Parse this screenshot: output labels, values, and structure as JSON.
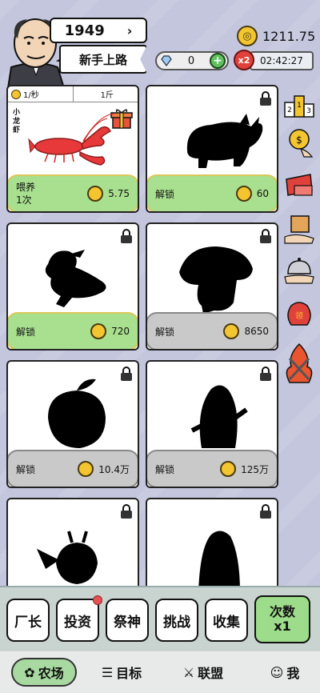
{
  "header": {
    "year": "1949",
    "title": "新手上路",
    "gold": "1211.75",
    "gems": "0",
    "boost_badge": "x2",
    "timer": "02:42:27"
  },
  "cards": [
    {
      "rate": "1/秒",
      "weight": "1斤",
      "name": "小龙虾",
      "action": "喂养",
      "sub": "1次",
      "price": "5.75",
      "style": "green"
    },
    {
      "action": "解锁",
      "price": "60",
      "style": "green"
    },
    {
      "action": "解锁",
      "price": "720",
      "style": "green"
    },
    {
      "action": "解锁",
      "price": "8650",
      "style": "grey"
    },
    {
      "action": "解锁",
      "price": "10.4万",
      "style": "grey"
    },
    {
      "action": "解锁",
      "price": "125万",
      "style": "grey"
    }
  ],
  "side": {
    "ranking_digits": [
      "2",
      "1",
      "3"
    ],
    "coupon_label": "领"
  },
  "toolbar": {
    "factory": "厂长",
    "invest": "投资",
    "festival": "祭神",
    "challenge": "挑战",
    "collect": "收集",
    "multiplier_top": "次数",
    "multiplier_bottom": "x1"
  },
  "tabs": {
    "farm": "农场",
    "goal": "目标",
    "alliance": "联盟",
    "me": "我"
  },
  "colors": {
    "background": "#c3c6dd",
    "green_action": "#a8e08f",
    "grey_action": "#c9c9c9",
    "coin": "#f3c531",
    "lobster": "#e8393a"
  }
}
